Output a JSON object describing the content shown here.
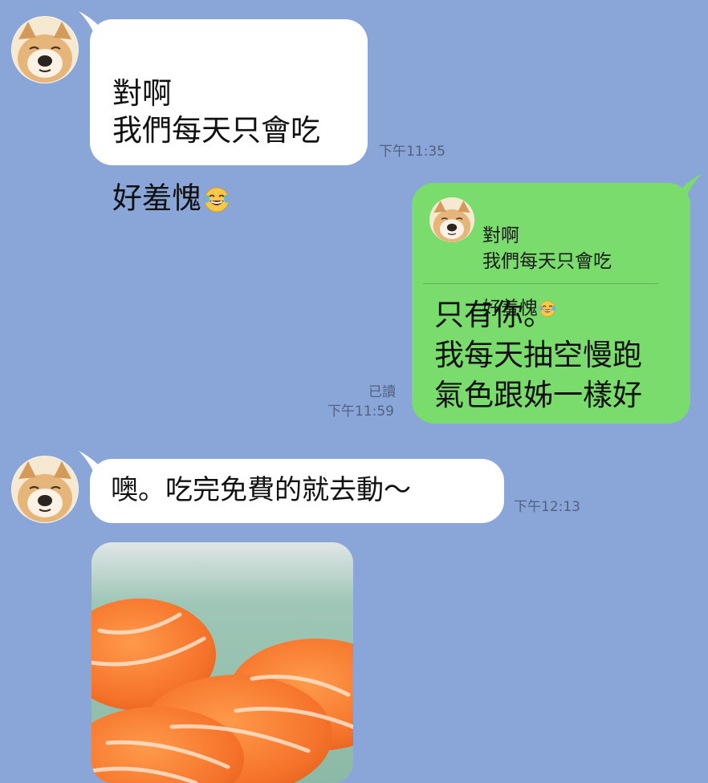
{
  "messages": [
    {
      "sender": "contact",
      "text": "對啊\n我們每天只會吃\n好羞愧",
      "emoji": "face-with-tears-of-joy-icon",
      "time": "下午11:35"
    },
    {
      "sender": "me",
      "reply_to": {
        "text": "對啊\n我們每天只會吃\n好羞愧",
        "emoji": "face-with-tears-of-joy-icon"
      },
      "text": "只有你。\n我每天抽空慢跑\n氣色跟姊一樣好",
      "read_label": "已讀",
      "time": "下午11:59"
    },
    {
      "sender": "contact",
      "text": "噢。吃完免費的就去動～",
      "time": "下午12:13"
    },
    {
      "sender": "contact",
      "type": "photo",
      "photo": "salmon-sushi-photo"
    }
  ],
  "colors": {
    "background": "#8aa6d8",
    "incoming_bubble": "#ffffff",
    "outgoing_bubble": "#79dc6c",
    "timestamp": "#51617e"
  }
}
